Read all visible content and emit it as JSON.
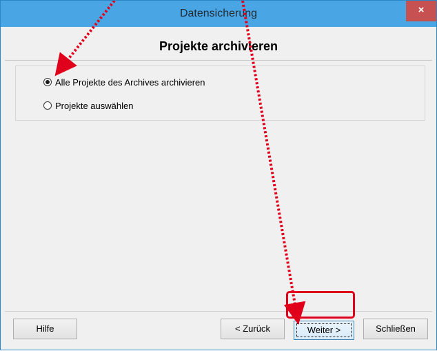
{
  "window": {
    "title": "Datensicherung",
    "close_glyph": "×"
  },
  "page": {
    "heading": "Projekte archivieren"
  },
  "options": [
    {
      "label": "Alle Projekte des Archives archivieren",
      "selected": true
    },
    {
      "label": "Projekte auswählen",
      "selected": false
    }
  ],
  "buttons": {
    "help": "Hilfe",
    "back": "< Zurück",
    "next": "Weiter >",
    "close": "Schließen"
  },
  "annotation": {
    "color": "#e0001b",
    "target": "next"
  }
}
